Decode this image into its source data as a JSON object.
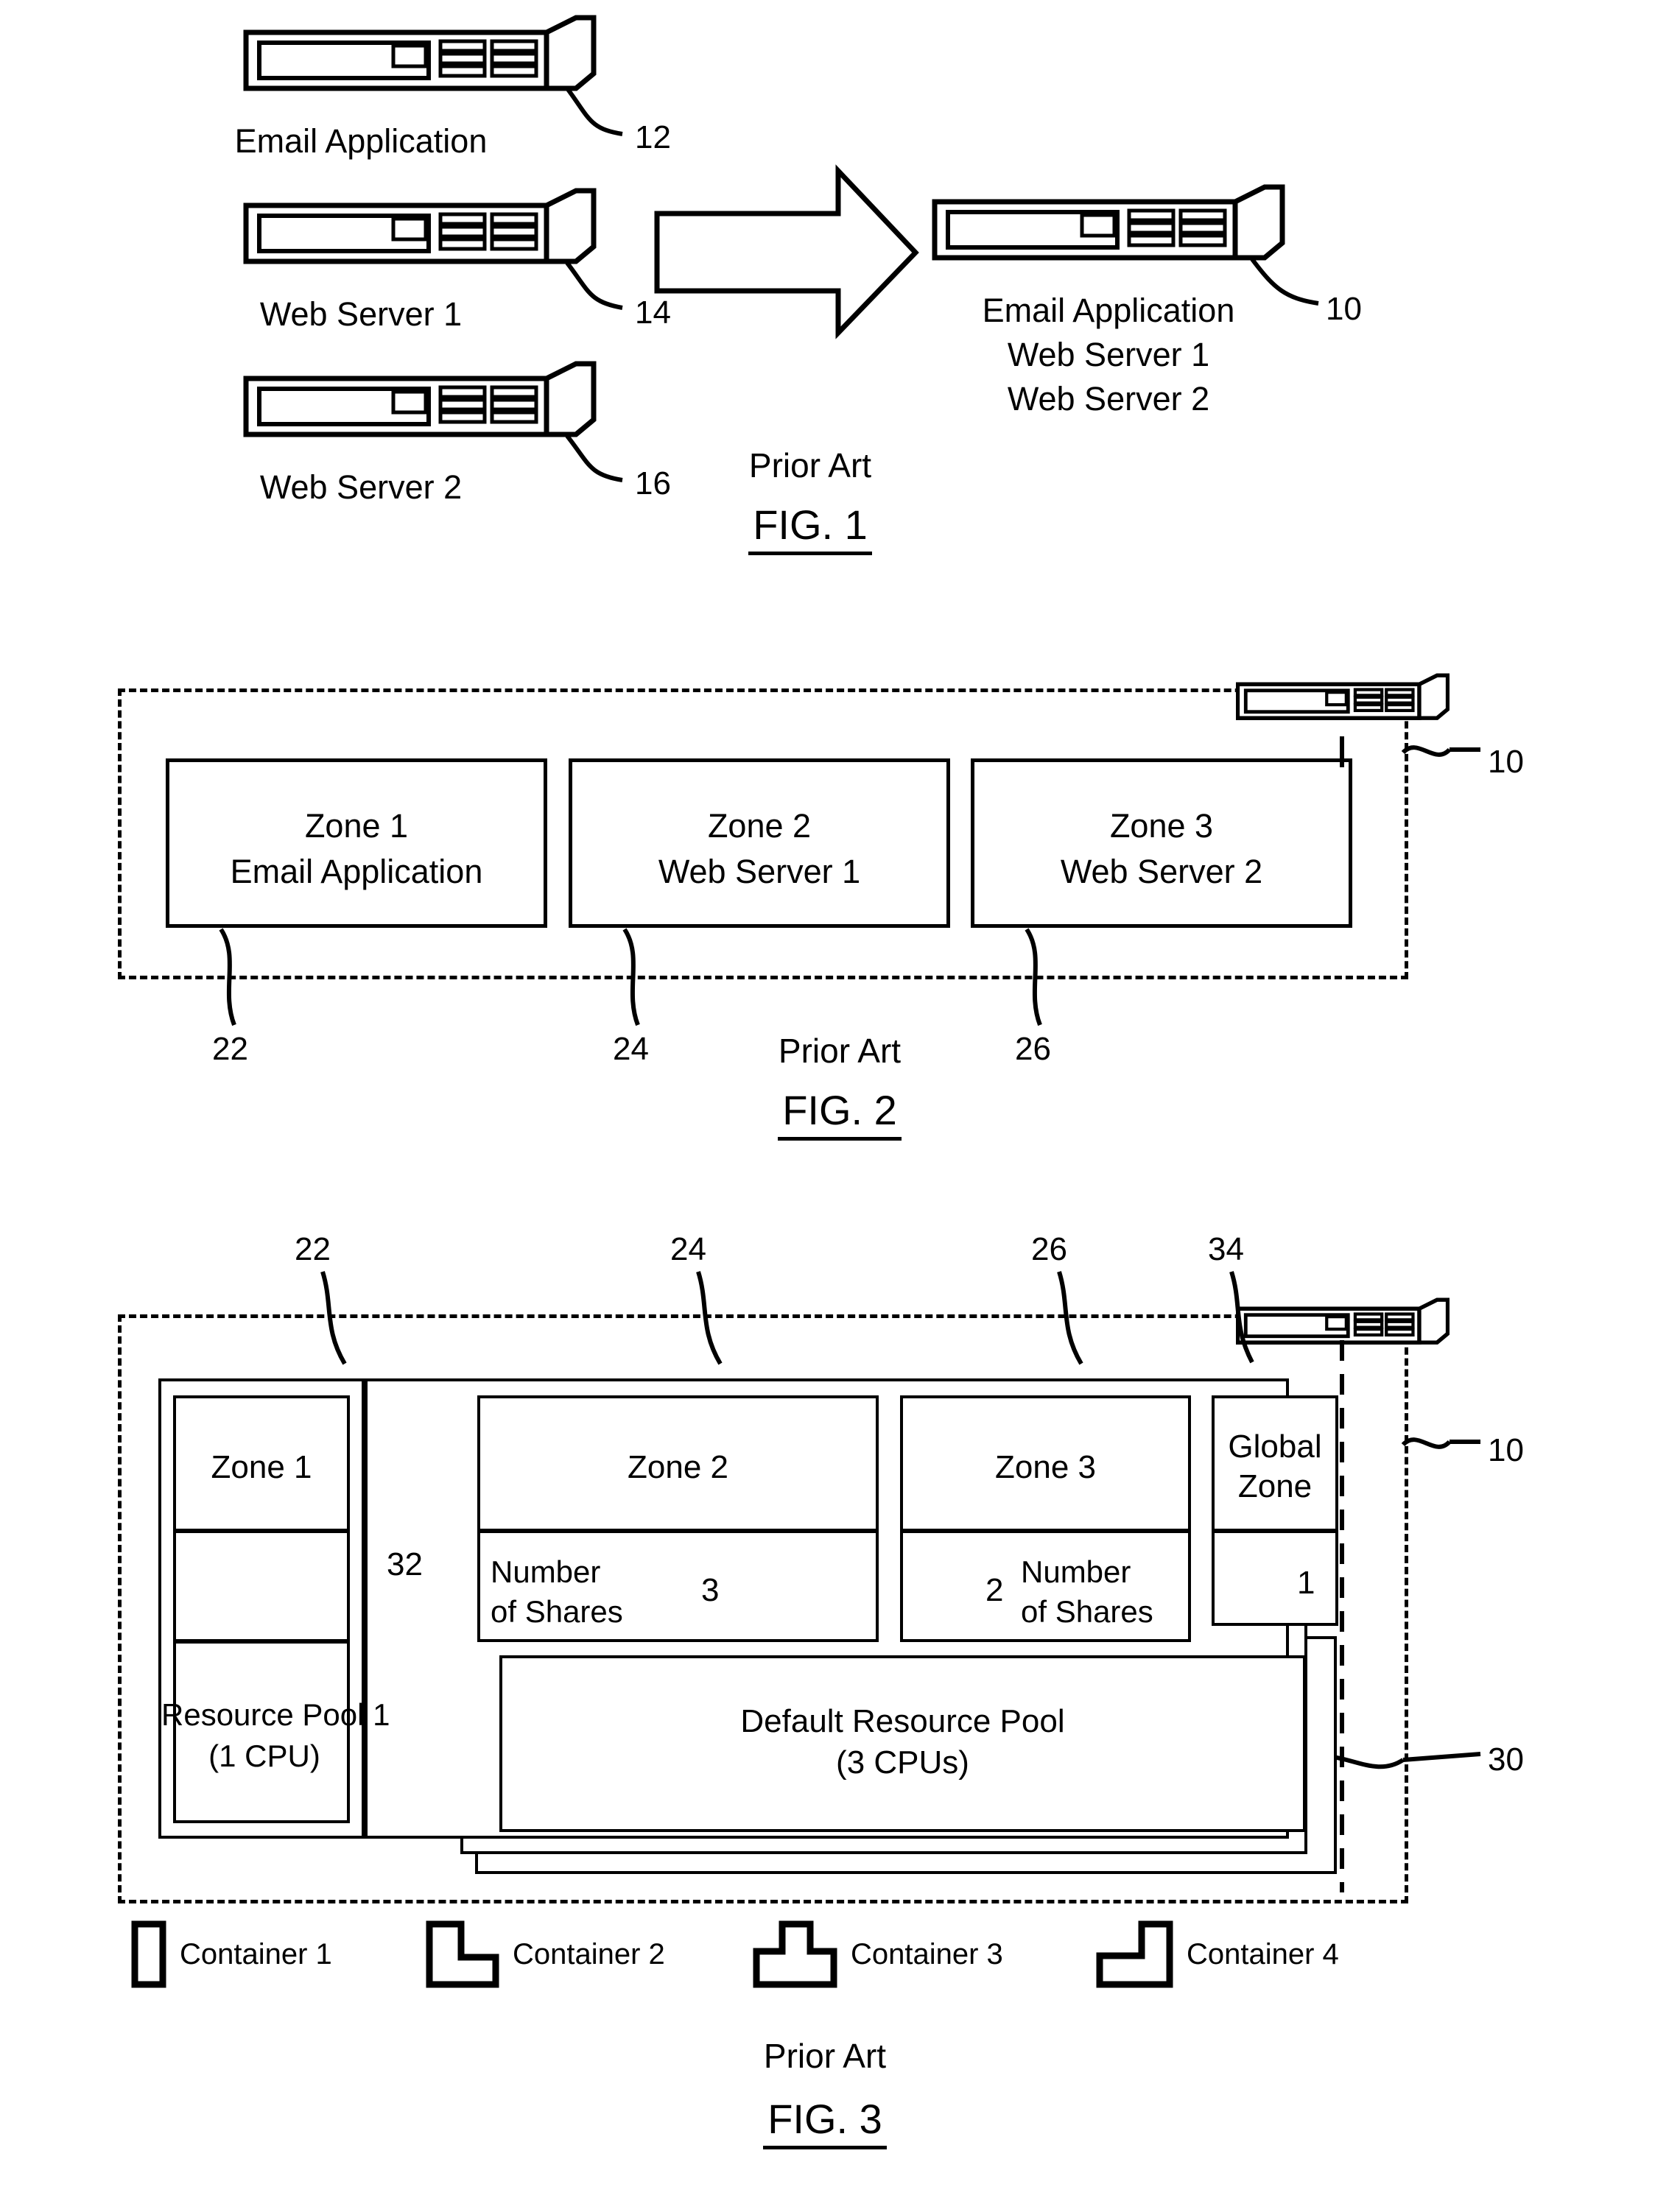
{
  "document": {
    "type": "patent-drawing-sheet",
    "figures": [
      {
        "id": "fig1",
        "prior_art_label": "Prior Art",
        "name": "FIG. 1",
        "servers": [
          {
            "label": "Email Application",
            "ref": "12"
          },
          {
            "label": "Web Server 1",
            "ref": "14"
          },
          {
            "label": "Web Server 2",
            "ref": "16"
          }
        ],
        "arrow": "consolidation-arrow",
        "target_server": {
          "ref": "10",
          "lines": [
            "Email Application",
            "Web Server 1",
            "Web Server 2"
          ]
        }
      },
      {
        "id": "fig2",
        "prior_art_label": "Prior Art",
        "name": "FIG. 2",
        "system_ref": "10",
        "zones": [
          {
            "title": "Zone 1",
            "subtitle": "Email Application",
            "ref": "22"
          },
          {
            "title": "Zone 2",
            "subtitle": "Web Server 1",
            "ref": "24"
          },
          {
            "title": "Zone 3",
            "subtitle": "Web Server 2",
            "ref": "26"
          }
        ]
      },
      {
        "id": "fig3",
        "prior_art_label": "Prior Art",
        "name": "FIG. 3",
        "system_ref": "10",
        "pool_ref": "30",
        "arrow_ref": "32",
        "zones": [
          {
            "title": "Zone 1",
            "ref": "22",
            "shares_label": "",
            "shares_value": ""
          },
          {
            "title": "Zone 2",
            "ref": "24",
            "shares_label": "Number\nof Shares",
            "shares_value": "3"
          },
          {
            "title": "Zone 3",
            "ref": "26",
            "shares_label": "Number\nof Shares",
            "shares_value": "2"
          },
          {
            "title": "Global\nZone",
            "ref": "34",
            "shares_label": "",
            "shares_value": "1"
          }
        ],
        "pools": [
          {
            "title": "Resource Pool 1",
            "capacity": "(1 CPU)"
          },
          {
            "title": "Default Resource Pool",
            "capacity": "(3 CPUs)"
          }
        ],
        "legend": [
          {
            "shape": "rect-icon",
            "label": "Container 1"
          },
          {
            "shape": "l-shape-icon",
            "label": "Container 2"
          },
          {
            "shape": "t-shape-icon",
            "label": "Container 3"
          },
          {
            "shape": "j-shape-icon",
            "label": "Container 4"
          }
        ]
      }
    ]
  }
}
